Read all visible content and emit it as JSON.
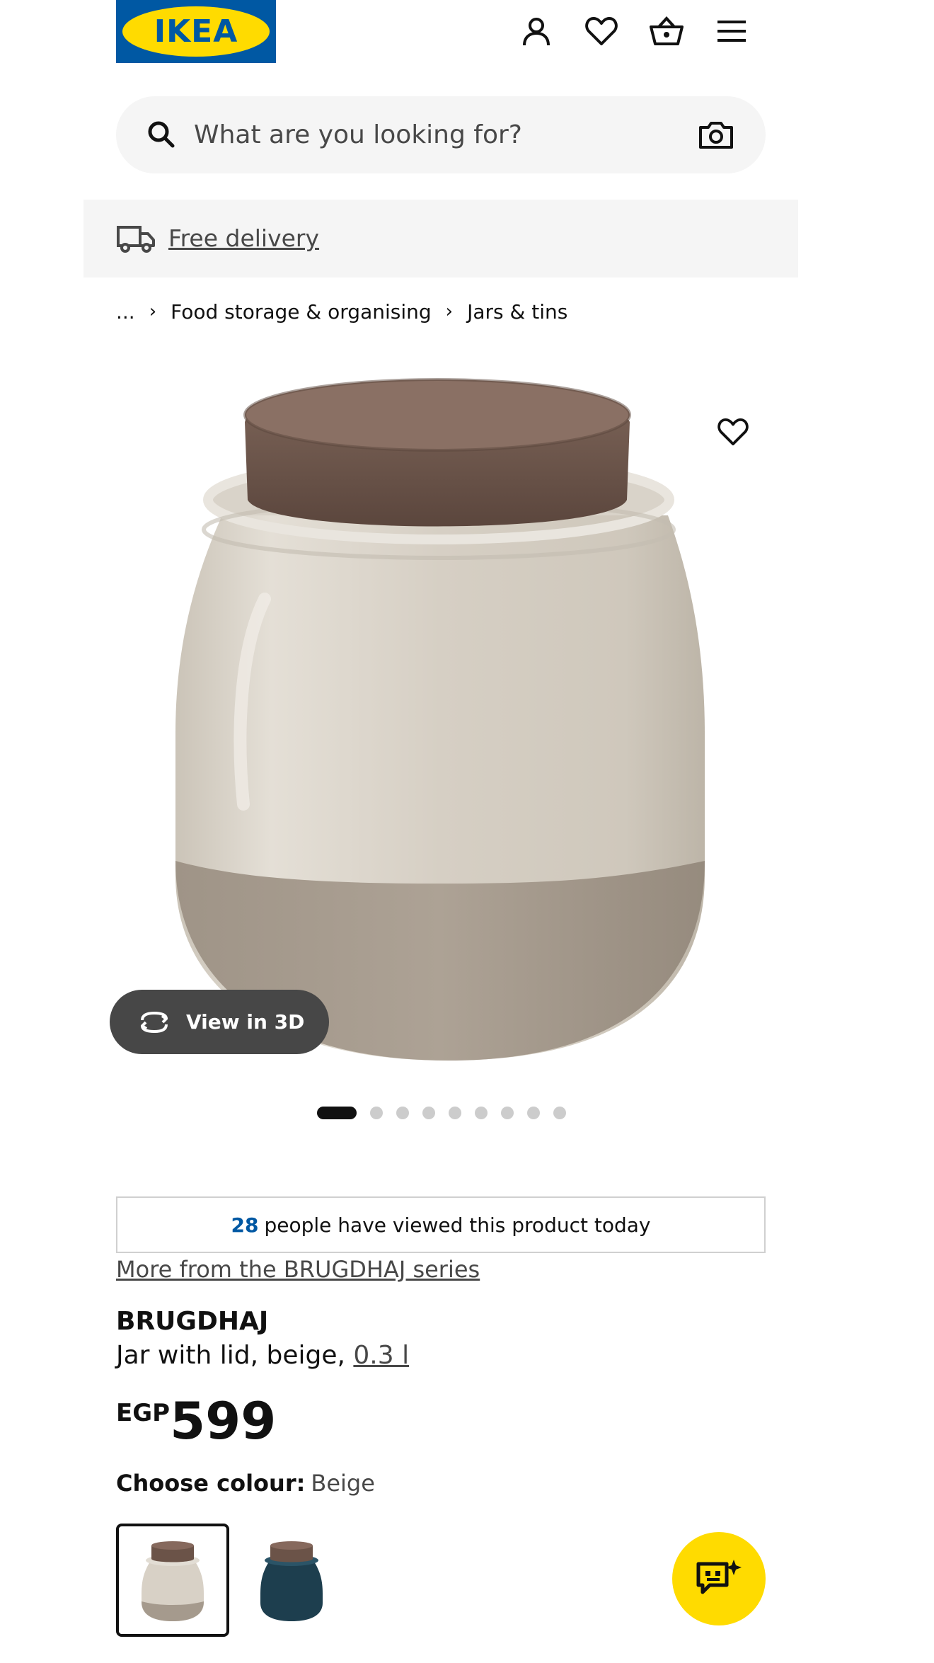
{
  "header": {
    "logo_text": "IKEA",
    "icons": [
      "account-icon",
      "wishlist-icon",
      "basket-icon",
      "menu-icon"
    ]
  },
  "search": {
    "placeholder": "What are you looking for?"
  },
  "delivery": {
    "label": "Free delivery"
  },
  "breadcrumb": {
    "ellipsis": "...",
    "items": [
      "Food storage & organising",
      "Jars & tins"
    ]
  },
  "gallery": {
    "view_3d_label": "View in 3D",
    "slide_count": 9,
    "active_slide": 1
  },
  "social_proof": {
    "count": "28",
    "text": "people have viewed this product today"
  },
  "product": {
    "series_link": "More from the BRUGDHAJ series",
    "name": "BRUGDHAJ",
    "description": "Jar with lid, beige,",
    "size": "0.3 l",
    "currency": "EGP",
    "price": "599",
    "colour_label": "Choose colour:",
    "colour_value": "Beige"
  },
  "colours": {
    "swatches": [
      {
        "name": "Beige",
        "body": "#d8d1c6",
        "base": "#a59a8d",
        "selected": true
      },
      {
        "name": "Dark blue",
        "body": "#1d3e4e",
        "base": "#1d3e4e",
        "selected": false
      }
    ]
  },
  "theme": {
    "brand_blue": "#0058a3",
    "brand_yellow": "#ffdb00"
  }
}
